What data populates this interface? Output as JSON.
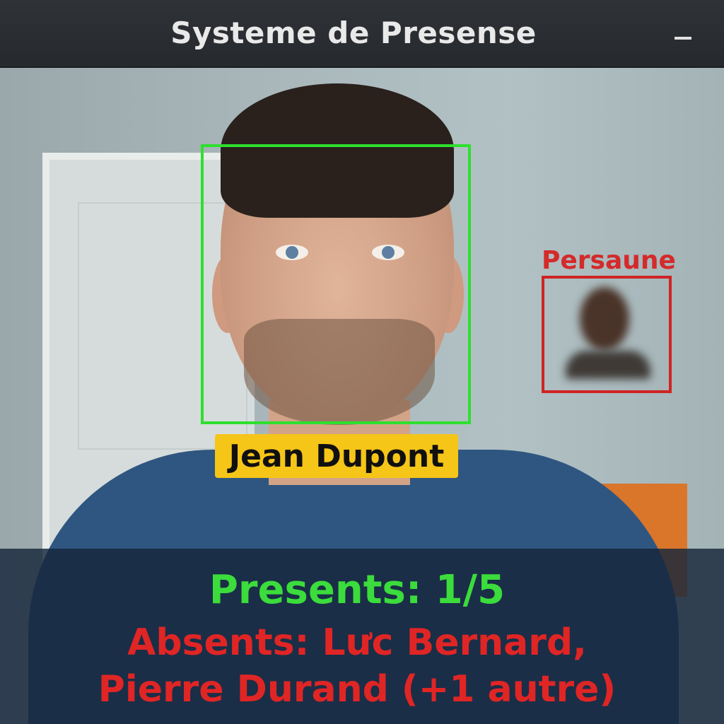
{
  "window": {
    "title": "Systeme de Presense",
    "minimize_symbol": "–"
  },
  "detections": {
    "known": {
      "name": "Jean Dupont",
      "status_color": "#2ee02e",
      "tag_color": "#f5c518"
    },
    "unknown": {
      "label": "Persaune",
      "status_color": "#cf2424"
    }
  },
  "summary": {
    "present_text": "Presents: 1/5",
    "absent_line1": "Absents: Lưc Bernard,",
    "absent_line2": "Pierre Durand (+1 autre)",
    "present_color": "#3bdc3b",
    "absent_color": "#e02525"
  }
}
